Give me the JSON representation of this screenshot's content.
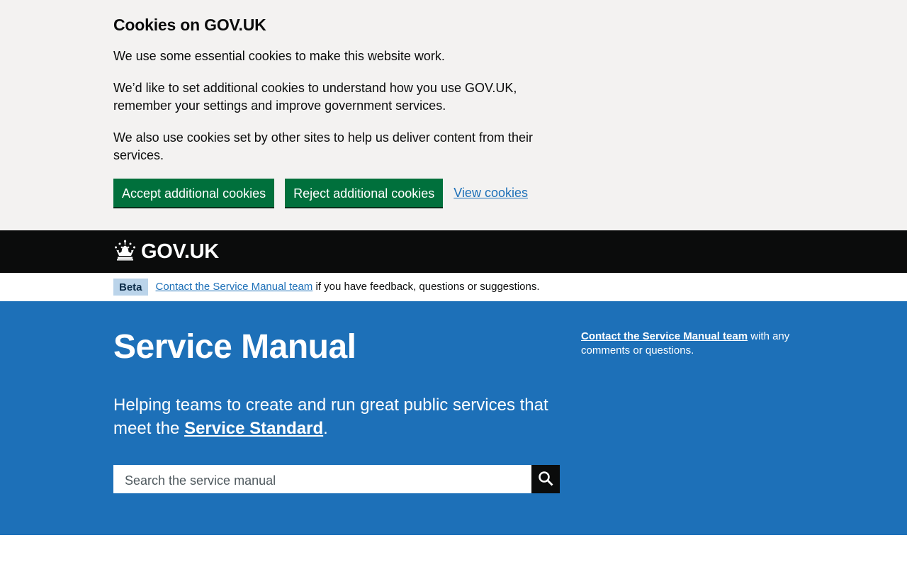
{
  "cookie_banner": {
    "title": "Cookies on GOV.UK",
    "paragraphs": [
      "We use some essential cookies to make this website work.",
      "We’d like to set additional cookies to understand how you use GOV.UK, remember your settings and improve government services.",
      "We also use cookies set by other sites to help us deliver content from their services."
    ],
    "accept_label": "Accept additional cookies",
    "reject_label": "Reject additional cookies",
    "view_label": "View cookies"
  },
  "header": {
    "logo_text": "GOV.UK",
    "logo_icon": "crown-icon"
  },
  "phase_banner": {
    "tag": "Beta",
    "link_text": "Contact the Service Manual team",
    "text": " if you have feedback, questions or suggestions."
  },
  "masthead": {
    "title": "Service Manual",
    "description_before": "Helping teams to create and run great public services that meet the ",
    "description_link": "Service Standard",
    "description_after": ".",
    "search_placeholder": "Search the service manual",
    "search_icon": "search-icon",
    "contact_link": "Contact the Service Manual team",
    "contact_text": " with any comments or questions."
  },
  "colors": {
    "banner_bg": "#f3f2f1",
    "button_green": "#00703c",
    "link_blue": "#1d70b8",
    "header_black": "#0b0c0c",
    "tag_bg": "#bbd4ea",
    "masthead_blue": "#1d70b8"
  }
}
